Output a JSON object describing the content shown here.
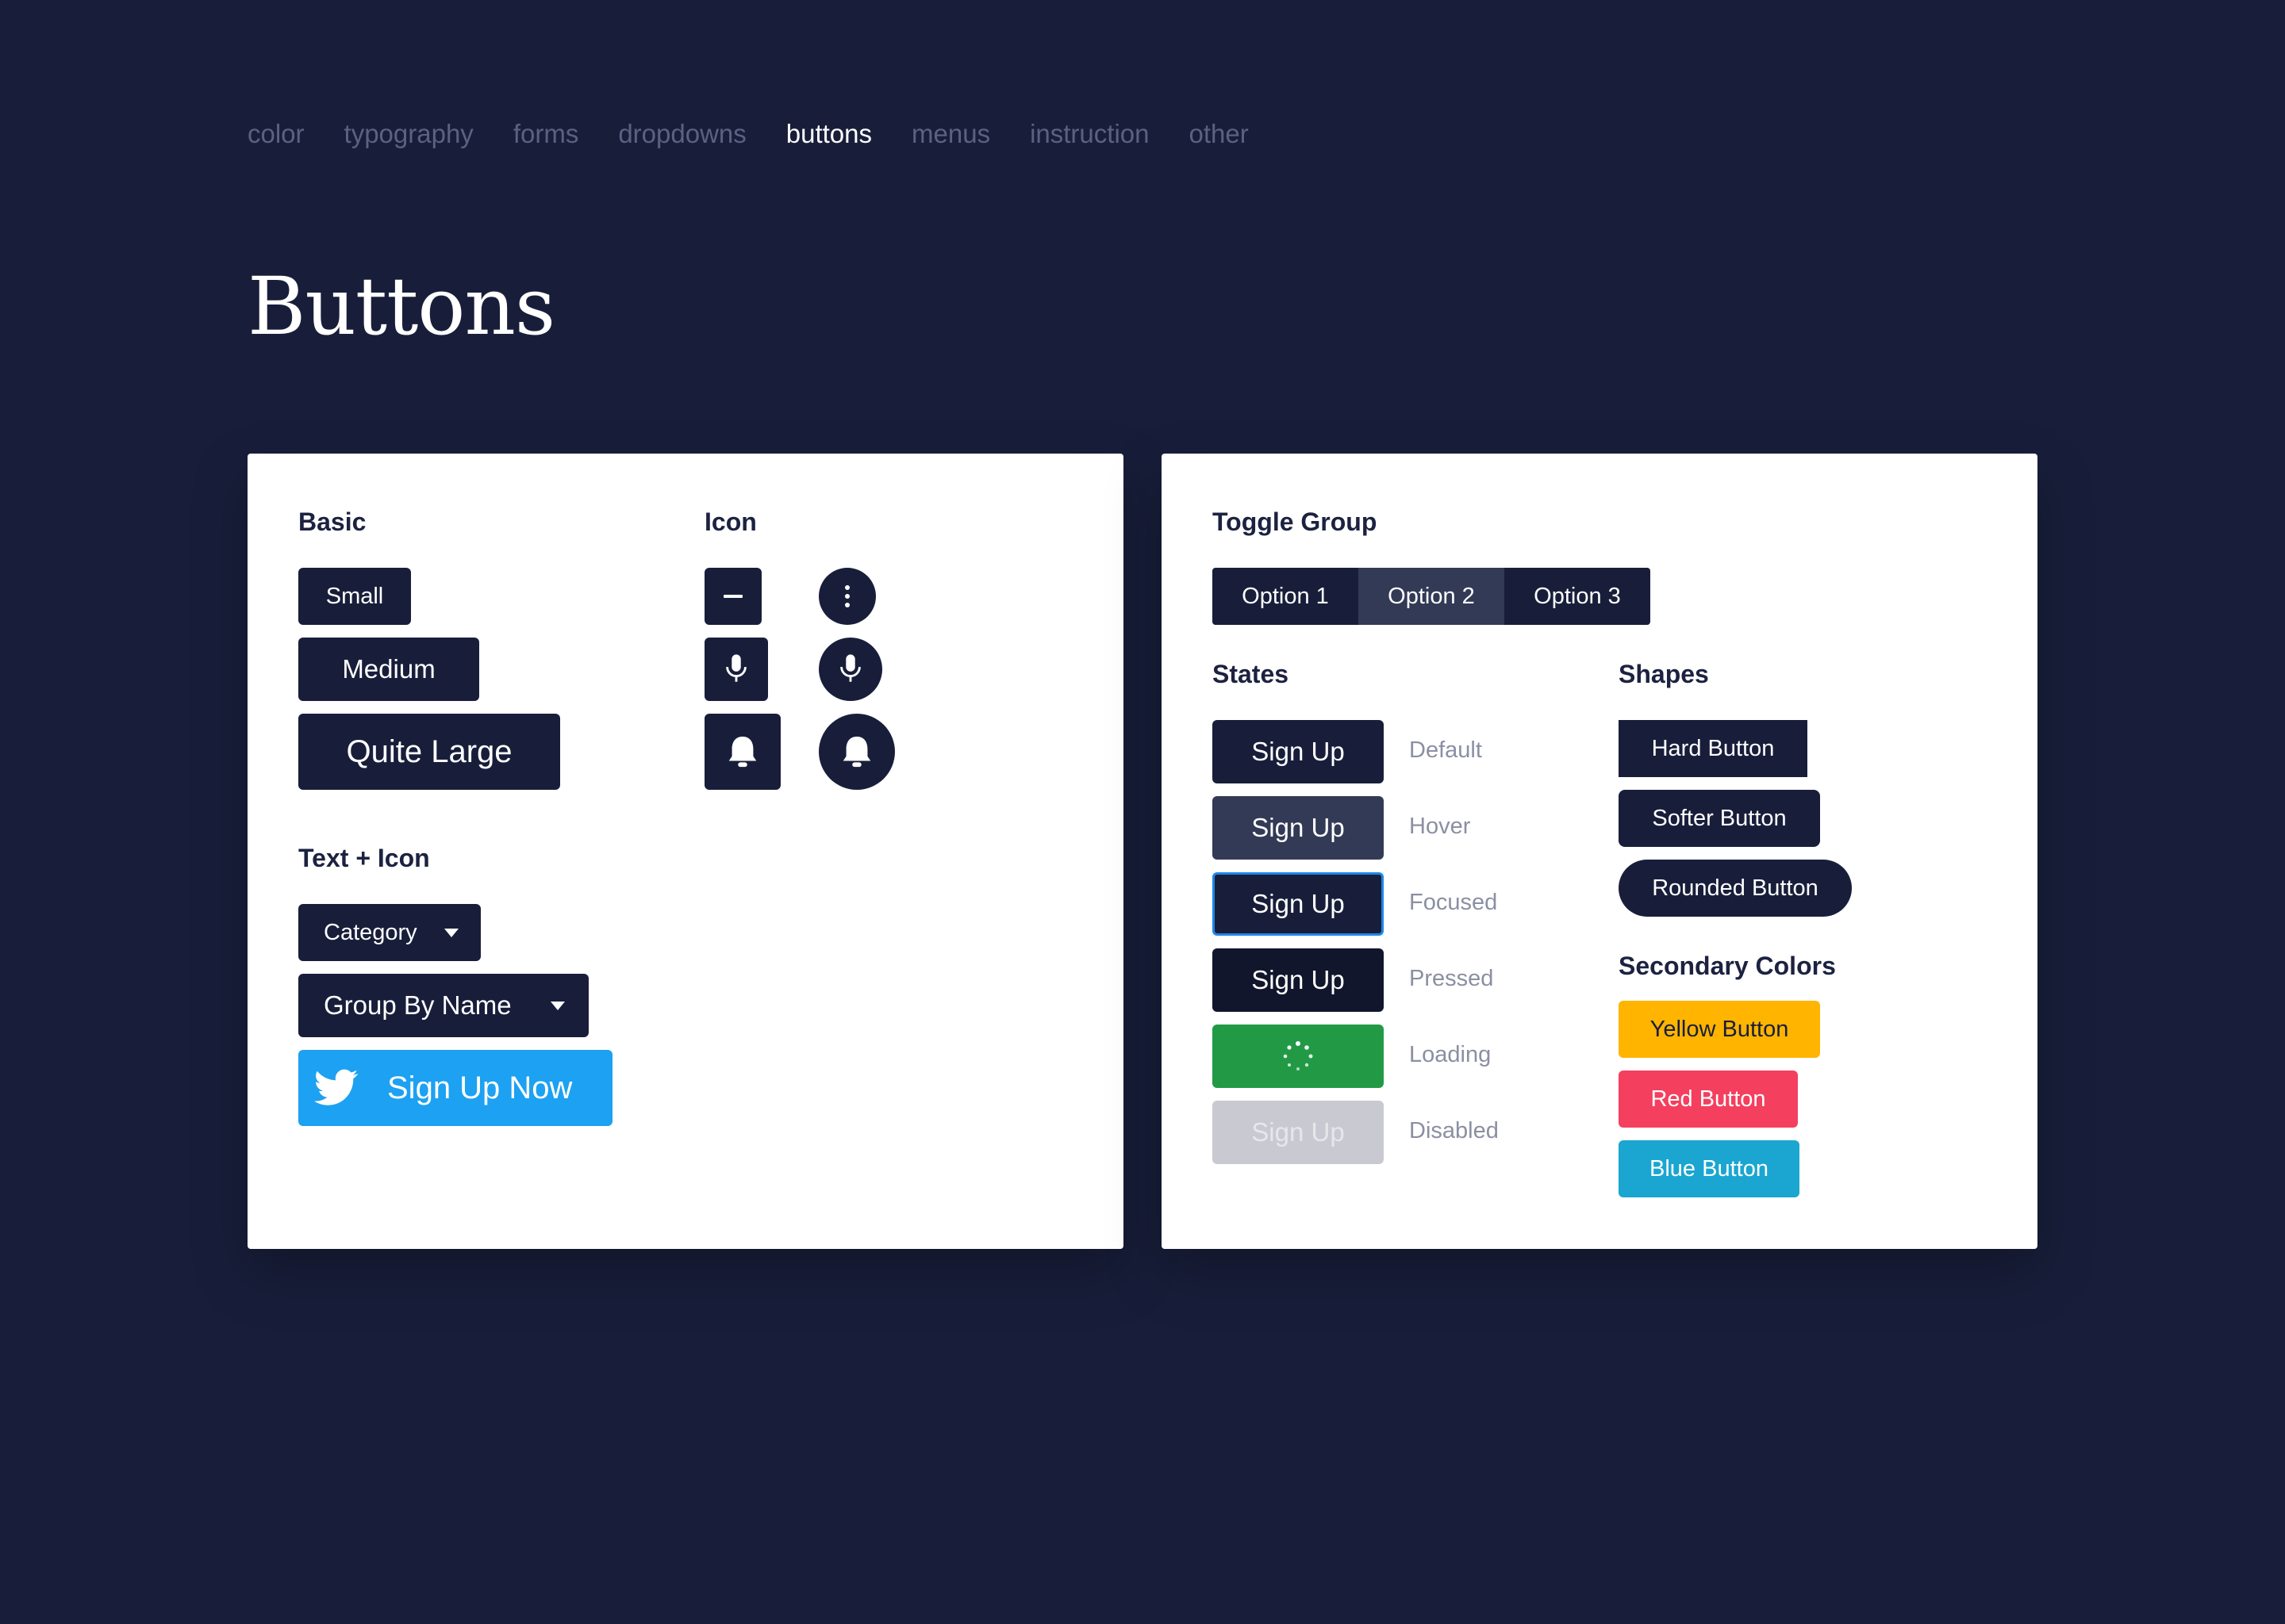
{
  "nav": {
    "items": [
      "color",
      "typography",
      "forms",
      "dropdowns",
      "buttons",
      "menus",
      "instruction",
      "other"
    ],
    "active": "buttons"
  },
  "page": {
    "title": "Buttons"
  },
  "left_panel": {
    "basic": {
      "title": "Basic",
      "small": "Small",
      "medium": "Medium",
      "large": "Quite Large"
    },
    "icon": {
      "title": "Icon",
      "icons": [
        "minus-icon",
        "more-vertical-icon",
        "microphone-icon",
        "microphone-icon",
        "bell-icon",
        "bell-icon"
      ]
    },
    "text_icon": {
      "title": "Text + Icon",
      "category": "Category",
      "group_by": "Group By Name",
      "twitter": "Sign Up Now"
    }
  },
  "right_panel": {
    "toggle_group": {
      "title": "Toggle Group",
      "options": [
        "Option 1",
        "Option 2",
        "Option 3"
      ],
      "selected": "Option 2"
    },
    "states": {
      "title": "States",
      "button_label": "Sign Up",
      "labels": [
        "Default",
        "Hover",
        "Focused",
        "Pressed",
        "Loading",
        "Disabled"
      ]
    },
    "shapes": {
      "title": "Shapes",
      "hard": "Hard Button",
      "softer": "Softer Button",
      "rounded": "Rounded Button"
    },
    "secondary": {
      "title": "Secondary Colors",
      "yellow": "Yellow Button",
      "red": "Red Button",
      "blue": "Blue Button"
    }
  },
  "colors": {
    "background": "#181e3a",
    "primary": "#181e3a",
    "hover": "#333a56",
    "focus_ring": "#1e88e5",
    "loading": "#229a45",
    "disabled": "#c9cad1",
    "twitter": "#1da1f2",
    "yellow": "#ffb400",
    "red": "#f43f5e",
    "blue": "#1aa6d1"
  }
}
